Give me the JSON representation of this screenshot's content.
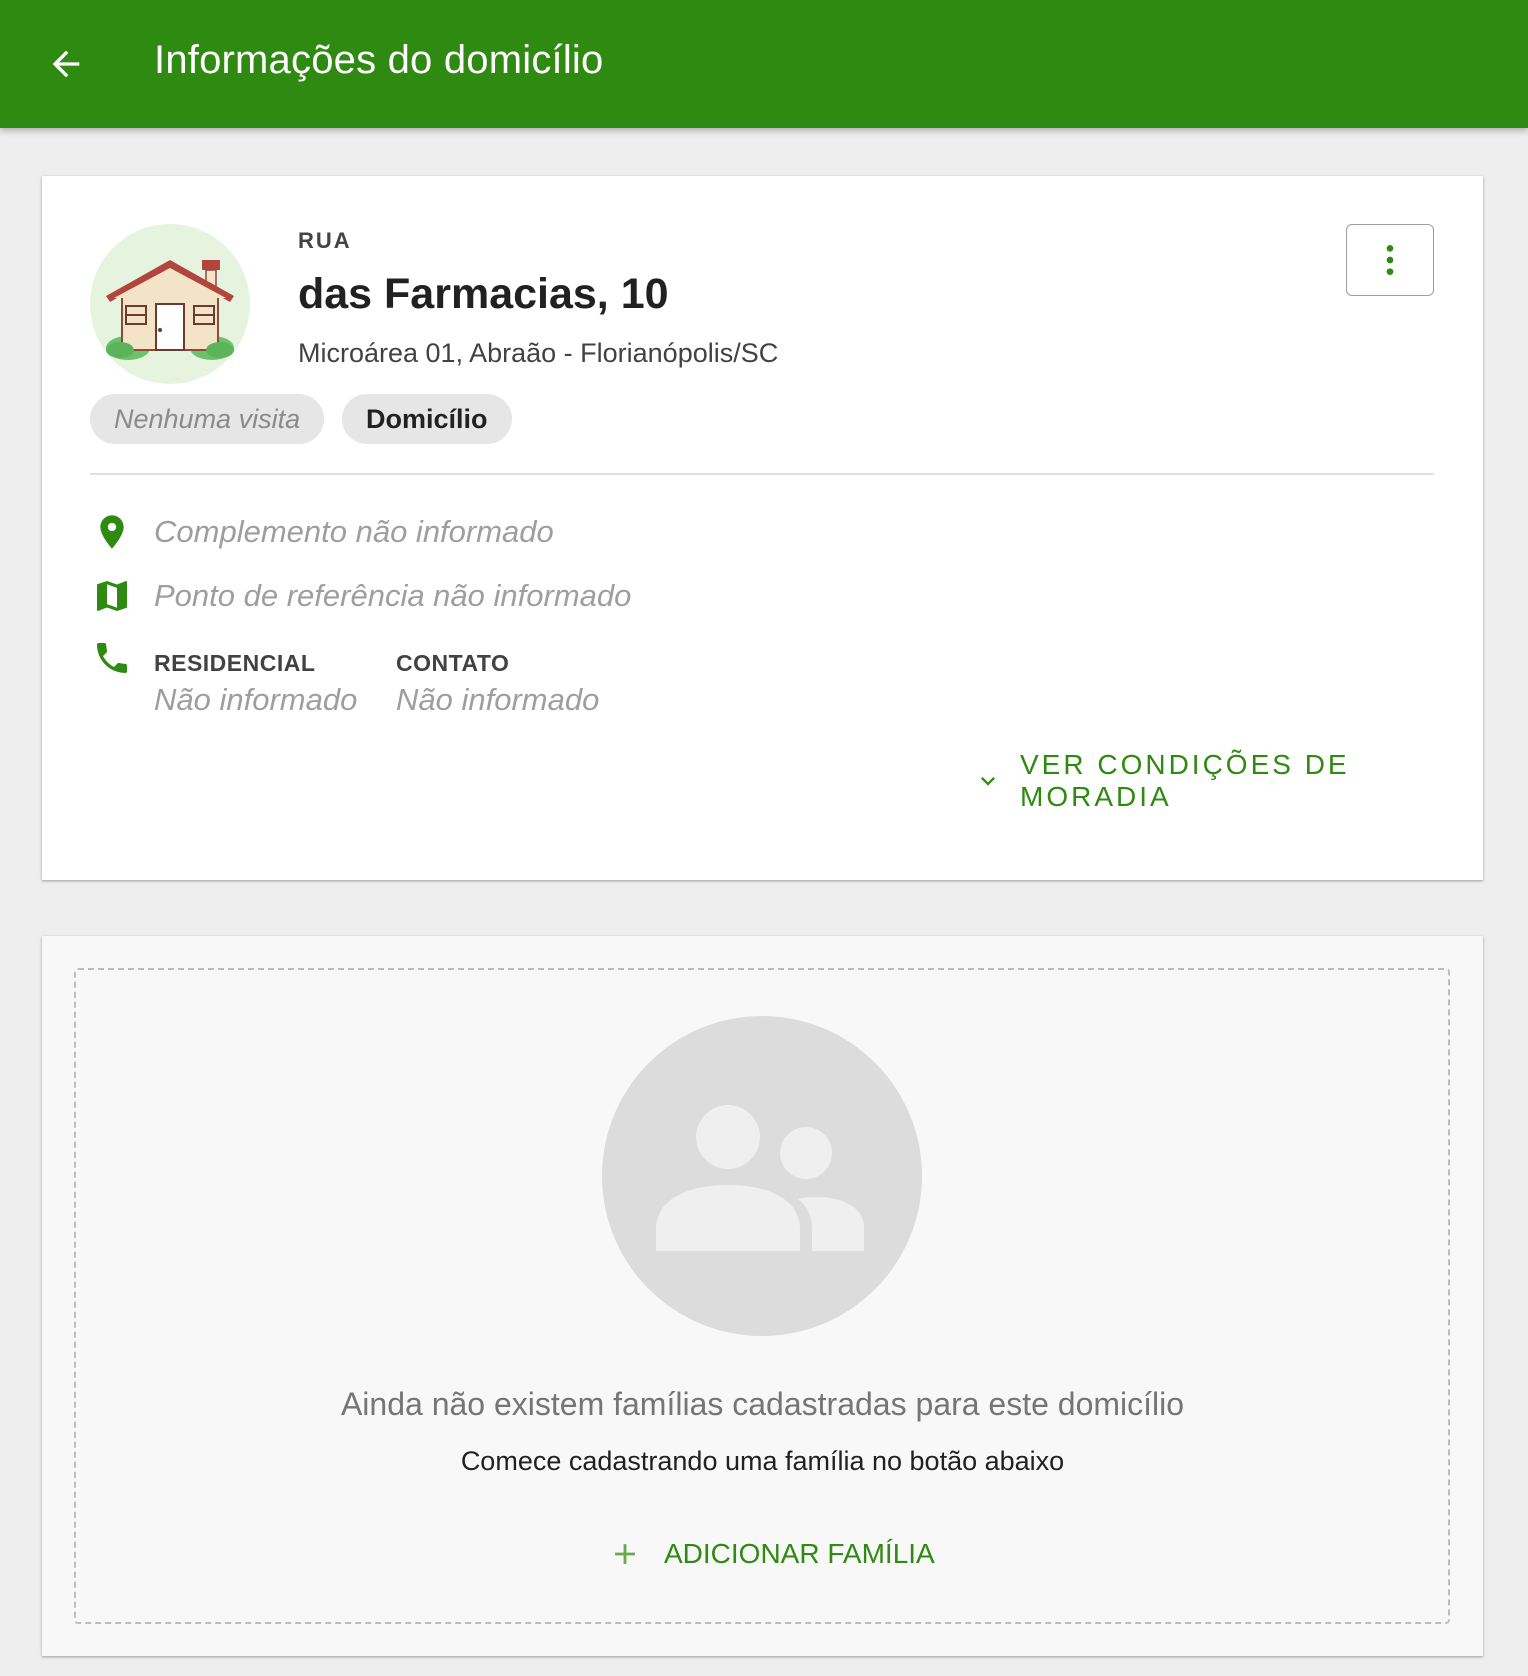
{
  "appbar": {
    "title": "Informações do domicílio",
    "back_icon": "arrow-left-icon",
    "color": "#2f8a12"
  },
  "address": {
    "type_label": "RUA",
    "title": "das Farmacias, 10",
    "subtitle": "Microárea 01, Abraão - Florianópolis/SC",
    "avatar_icon": "house-icon",
    "more_icon": "more-vertical-icon",
    "chips": {
      "visits": "Nenhuma visita",
      "type": "Domicílio"
    },
    "complement": "Complemento não informado",
    "reference": "Ponto de referência não informado",
    "phones": {
      "residential_label": "RESIDENCIAL",
      "residential_value": "Não informado",
      "contact_label": "CONTATO",
      "contact_value": "Não informado"
    },
    "conditions_link": "VER CONDIÇÕES DE MORADIA"
  },
  "families": {
    "empty_title": "Ainda não existem famílias cadastradas para este domicílio",
    "empty_subtitle": "Comece cadastrando uma família no botão abaixo",
    "add_label": "ADICIONAR FAMÍLIA",
    "empty_icon": "people-icon"
  }
}
